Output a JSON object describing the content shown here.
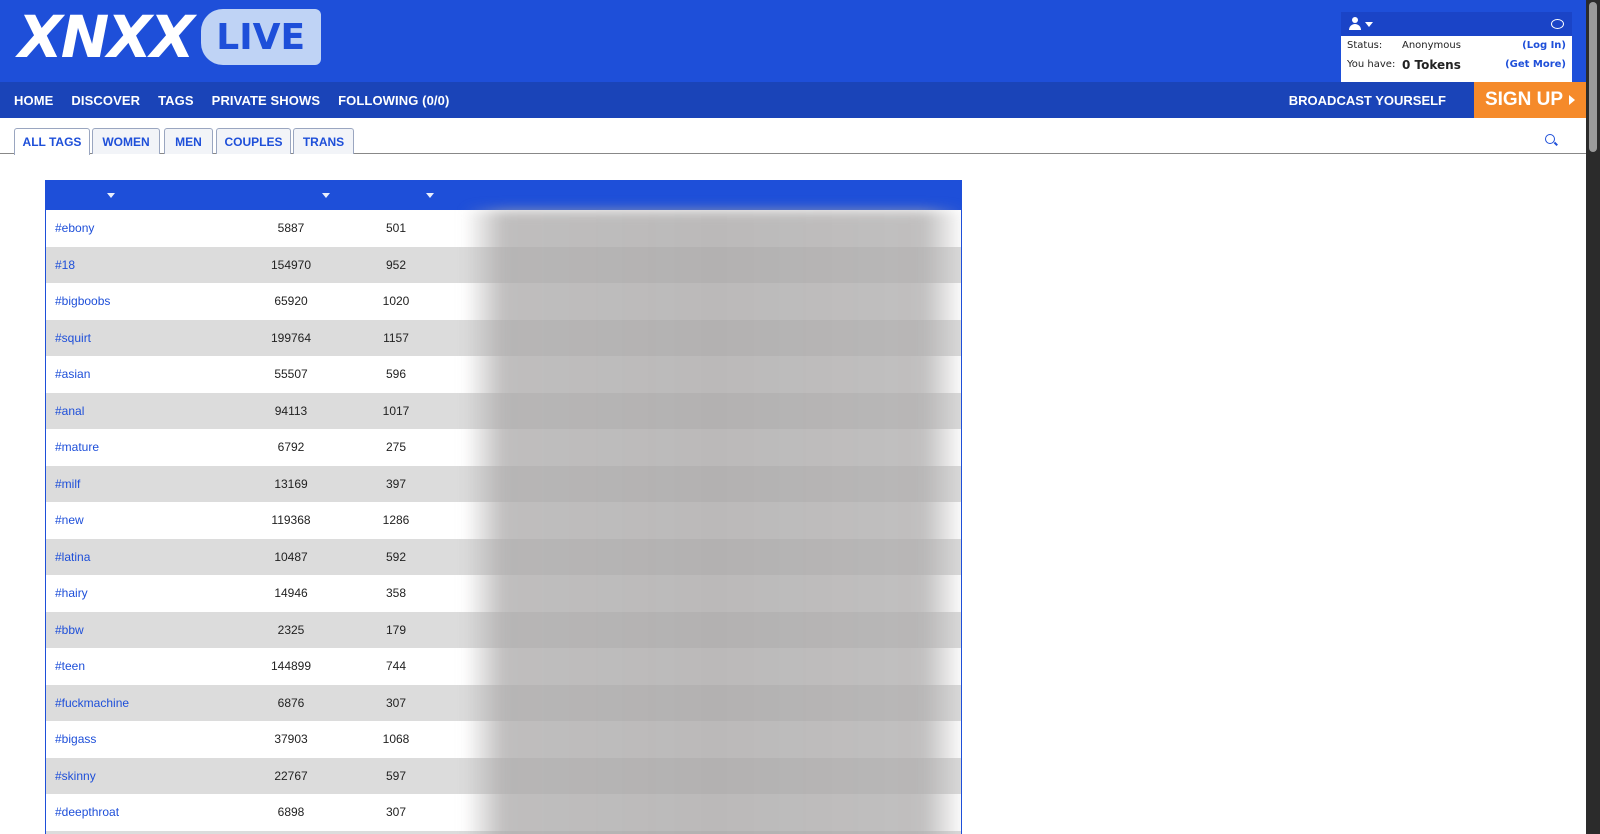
{
  "logo": {
    "main": "XNXX",
    "pill": "LIVE"
  },
  "account": {
    "status_label": "Status:",
    "status_value": "Anonymous",
    "login_link": "(Log In)",
    "tokens_label": "You have:",
    "tokens_value": "0 Tokens",
    "get_more_link": "(Get More)"
  },
  "nav": {
    "items": [
      "HOME",
      "DISCOVER",
      "TAGS",
      "PRIVATE SHOWS",
      "FOLLOWING (0/0)"
    ],
    "broadcast": "BROADCAST YOURSELF",
    "signup": "SIGN UP"
  },
  "tabs": [
    "ALL TAGS",
    "WOMEN",
    "MEN",
    "COUPLES",
    "TRANS"
  ],
  "table": {
    "rows": [
      {
        "tag": "#ebony",
        "viewers": "5887",
        "rooms": "501"
      },
      {
        "tag": "#18",
        "viewers": "154970",
        "rooms": "952"
      },
      {
        "tag": "#bigboobs",
        "viewers": "65920",
        "rooms": "1020"
      },
      {
        "tag": "#squirt",
        "viewers": "199764",
        "rooms": "1157"
      },
      {
        "tag": "#asian",
        "viewers": "55507",
        "rooms": "596"
      },
      {
        "tag": "#anal",
        "viewers": "94113",
        "rooms": "1017"
      },
      {
        "tag": "#mature",
        "viewers": "6792",
        "rooms": "275"
      },
      {
        "tag": "#milf",
        "viewers": "13169",
        "rooms": "397"
      },
      {
        "tag": "#new",
        "viewers": "119368",
        "rooms": "1286"
      },
      {
        "tag": "#latina",
        "viewers": "10487",
        "rooms": "592"
      },
      {
        "tag": "#hairy",
        "viewers": "14946",
        "rooms": "358"
      },
      {
        "tag": "#bbw",
        "viewers": "2325",
        "rooms": "179"
      },
      {
        "tag": "#teen",
        "viewers": "144899",
        "rooms": "744"
      },
      {
        "tag": "#fuckmachine",
        "viewers": "6876",
        "rooms": "307"
      },
      {
        "tag": "#bigass",
        "viewers": "37903",
        "rooms": "1068"
      },
      {
        "tag": "#skinny",
        "viewers": "22767",
        "rooms": "597"
      },
      {
        "tag": "#deepthroat",
        "viewers": "6898",
        "rooms": "307"
      },
      {
        "tag": "",
        "viewers": "",
        "rooms": ""
      }
    ]
  },
  "colors": {
    "brand_blue": "#1e4fd9",
    "nav_blue": "#1a44b8",
    "signup_orange": "#f58a2a"
  }
}
